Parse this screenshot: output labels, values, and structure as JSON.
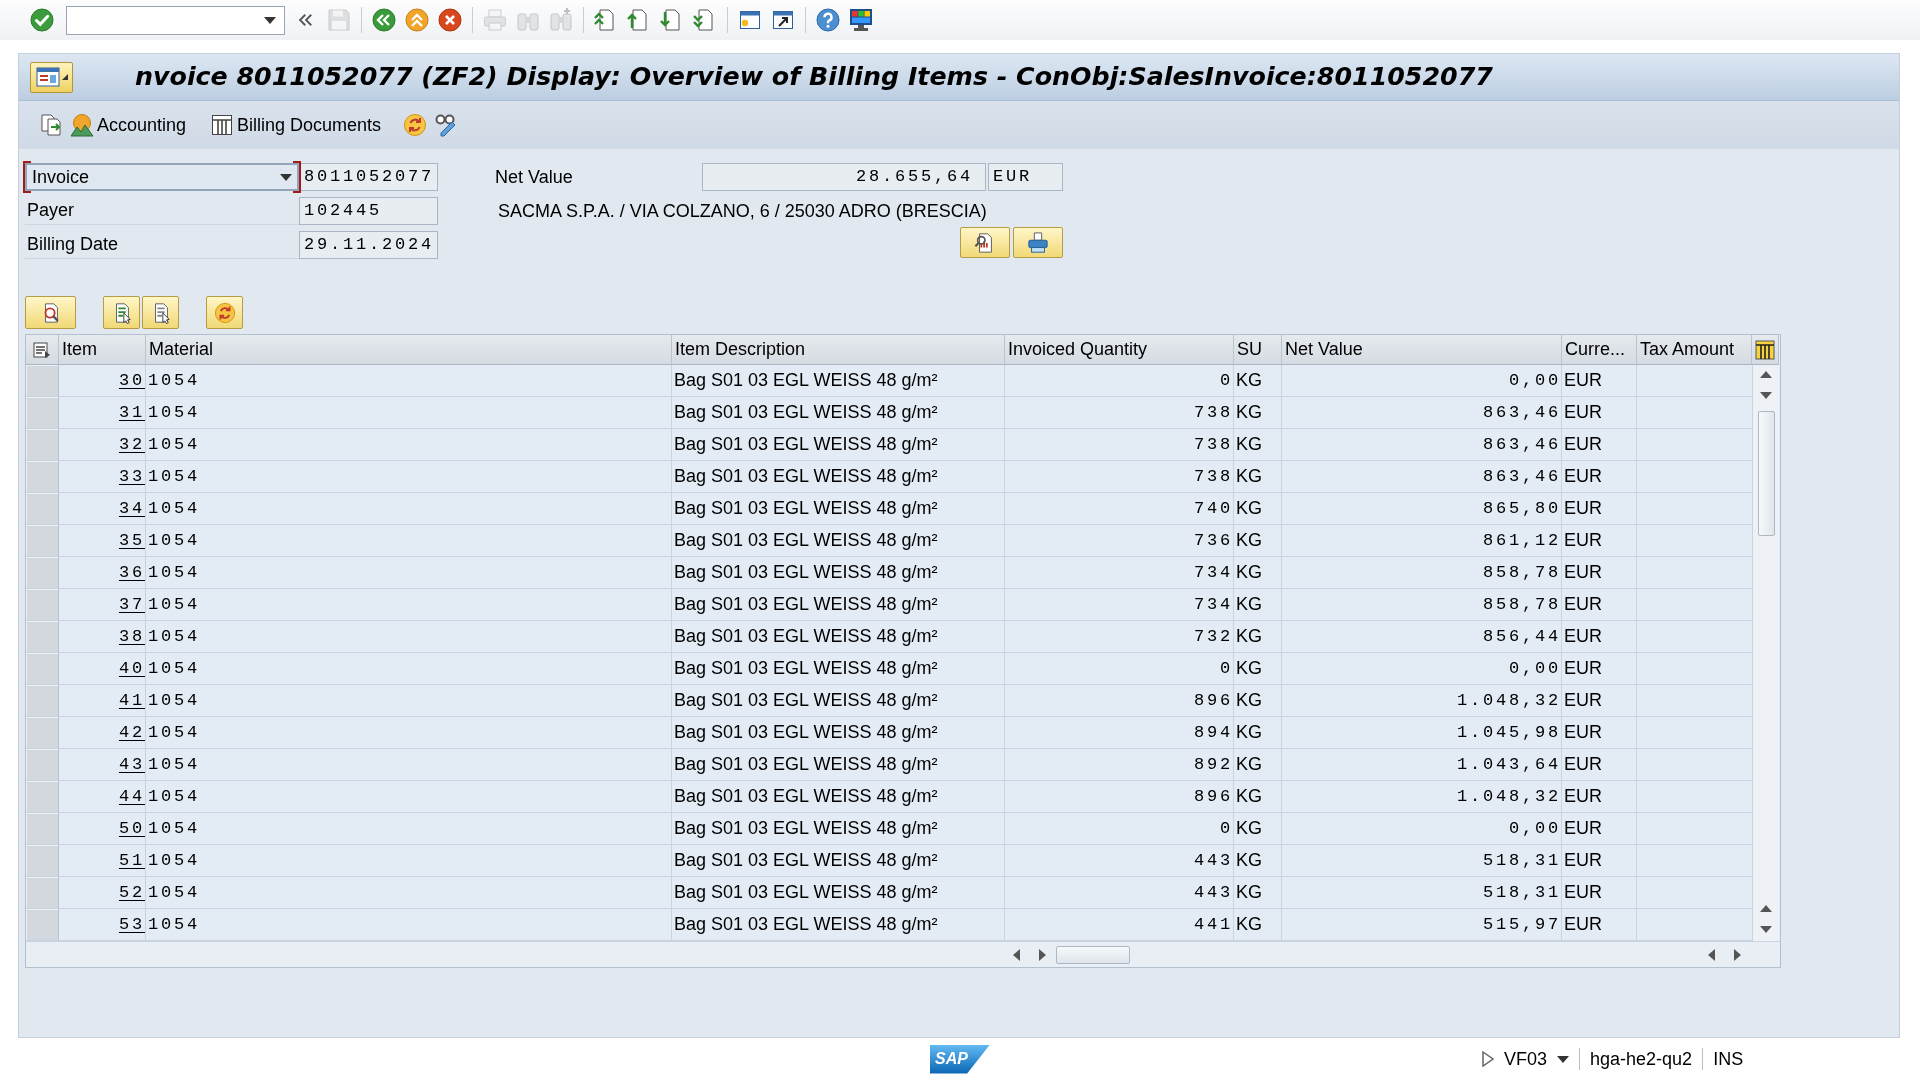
{
  "system_toolbar": [
    [
      {
        "kind": "enter",
        "disabled": false
      },
      {
        "kind": "command",
        "disabled": false
      },
      {
        "kind": "history",
        "disabled": false
      },
      {
        "kind": "save",
        "disabled": true
      }
    ],
    [
      {
        "kind": "back",
        "disabled": false
      },
      {
        "kind": "exit",
        "disabled": false
      },
      {
        "kind": "cancel",
        "disabled": false
      }
    ],
    [
      {
        "kind": "print",
        "disabled": true
      },
      {
        "kind": "find",
        "disabled": true
      },
      {
        "kind": "findnext",
        "disabled": true
      }
    ],
    [
      {
        "kind": "first",
        "disabled": false
      },
      {
        "kind": "previous",
        "disabled": false
      },
      {
        "kind": "next",
        "disabled": false
      },
      {
        "kind": "last",
        "disabled": false
      }
    ],
    [
      {
        "kind": "session",
        "disabled": false
      },
      {
        "kind": "shortcut",
        "disabled": false
      }
    ],
    [
      {
        "kind": "help",
        "disabled": false
      },
      {
        "kind": "customize",
        "disabled": false
      }
    ]
  ],
  "window": {
    "title": "nvoice 8011052077 (ZF2) Display: Overview of Billing Items - ConObj:SalesInvoice:8011052077"
  },
  "app_toolbar": [
    {
      "kind": "overview"
    },
    {
      "kind": "accounting",
      "label": "Accounting"
    },
    {
      "kind": "documents",
      "label": "Billing Documents"
    },
    {
      "kind": "flow"
    },
    {
      "kind": "display"
    }
  ],
  "header": {
    "document_type": {
      "value": "Invoice",
      "focused": true
    },
    "document_number": "8011052077",
    "fields": [
      {
        "label": "Payer",
        "value": "102445"
      },
      {
        "label": "Billing Date",
        "value": "29.11.2024"
      }
    ],
    "net_value": {
      "label": "Net Value",
      "value": "28.655,64",
      "currency": "EUR"
    },
    "payer_address": "SACMA S.P.A. / VIA COLZANO, 6 / 25030 ADRO (BRESCIA)",
    "buttons": [
      {
        "kind": "analysis"
      },
      {
        "kind": "output"
      }
    ]
  },
  "table_toolbar": [
    [
      {
        "kind": "details"
      }
    ],
    [
      {
        "kind": "select"
      },
      {
        "kind": "deselect"
      }
    ],
    [
      {
        "kind": "refresh"
      }
    ]
  ],
  "table": {
    "columns": [
      "Item",
      "Material",
      "Item Description",
      "Invoiced Quantity",
      "SU",
      "Net Value",
      "Curre...",
      "Tax Amount"
    ],
    "rows": [
      {
        "item": "30",
        "material": "1054",
        "description": "Bag S01 03 EGL WEISS 48 g/m²",
        "quantity": "0",
        "unit": "KG",
        "net_value": "0,00",
        "currency": "EUR",
        "selected": false
      },
      {
        "item": "31",
        "material": "1054",
        "description": "Bag S01 03 EGL WEISS 48 g/m²",
        "quantity": "738",
        "unit": "KG",
        "net_value": "863,46",
        "currency": "EUR",
        "selected": false
      },
      {
        "item": "32",
        "material": "1054",
        "description": "Bag S01 03 EGL WEISS 48 g/m²",
        "quantity": "738",
        "unit": "KG",
        "net_value": "863,46",
        "currency": "EUR",
        "selected": false
      },
      {
        "item": "33",
        "material": "1054",
        "description": "Bag S01 03 EGL WEISS 48 g/m²",
        "quantity": "738",
        "unit": "KG",
        "net_value": "863,46",
        "currency": "EUR",
        "selected": false
      },
      {
        "item": "34",
        "material": "1054",
        "description": "Bag S01 03 EGL WEISS 48 g/m²",
        "quantity": "740",
        "unit": "KG",
        "net_value": "865,80",
        "currency": "EUR",
        "selected": false
      },
      {
        "item": "35",
        "material": "1054",
        "description": "Bag S01 03 EGL WEISS 48 g/m²",
        "quantity": "736",
        "unit": "KG",
        "net_value": "861,12",
        "currency": "EUR",
        "selected": false
      },
      {
        "item": "36",
        "material": "1054",
        "description": "Bag S01 03 EGL WEISS 48 g/m²",
        "quantity": "734",
        "unit": "KG",
        "net_value": "858,78",
        "currency": "EUR",
        "selected": false
      },
      {
        "item": "37",
        "material": "1054",
        "description": "Bag S01 03 EGL WEISS 48 g/m²",
        "quantity": "734",
        "unit": "KG",
        "net_value": "858,78",
        "currency": "EUR",
        "selected": false
      },
      {
        "item": "38",
        "material": "1054",
        "description": "Bag S01 03 EGL WEISS 48 g/m²",
        "quantity": "732",
        "unit": "KG",
        "net_value": "856,44",
        "currency": "EUR",
        "selected": false
      },
      {
        "item": "40",
        "material": "1054",
        "description": "Bag S01 03 EGL WEISS 48 g/m²",
        "quantity": "0",
        "unit": "KG",
        "net_value": "0,00",
        "currency": "EUR",
        "selected": false
      },
      {
        "item": "41",
        "material": "1054",
        "description": "Bag S01 03 EGL WEISS 48 g/m²",
        "quantity": "896",
        "unit": "KG",
        "net_value": "1.048,32",
        "currency": "EUR",
        "selected": false
      },
      {
        "item": "42",
        "material": "1054",
        "description": "Bag S01 03 EGL WEISS 48 g/m²",
        "quantity": "894",
        "unit": "KG",
        "net_value": "1.045,98",
        "currency": "EUR",
        "selected": false
      },
      {
        "item": "43",
        "material": "1054",
        "description": "Bag S01 03 EGL WEISS 48 g/m²",
        "quantity": "892",
        "unit": "KG",
        "net_value": "1.043,64",
        "currency": "EUR",
        "selected": false
      },
      {
        "item": "44",
        "material": "1054",
        "description": "Bag S01 03 EGL WEISS 48 g/m²",
        "quantity": "896",
        "unit": "KG",
        "net_value": "1.048,32",
        "currency": "EUR",
        "selected": false
      },
      {
        "item": "50",
        "material": "1054",
        "description": "Bag S01 03 EGL WEISS 48 g/m²",
        "quantity": "0",
        "unit": "KG",
        "net_value": "0,00",
        "currency": "EUR",
        "selected": false
      },
      {
        "item": "51",
        "material": "1054",
        "description": "Bag S01 03 EGL WEISS 48 g/m²",
        "quantity": "443",
        "unit": "KG",
        "net_value": "518,31",
        "currency": "EUR",
        "selected": false
      },
      {
        "item": "52",
        "material": "1054",
        "description": "Bag S01 03 EGL WEISS 48 g/m²",
        "quantity": "443",
        "unit": "KG",
        "net_value": "518,31",
        "currency": "EUR",
        "selected": false
      },
      {
        "item": "53",
        "material": "1054",
        "description": "Bag S01 03 EGL WEISS 48 g/m²",
        "quantity": "441",
        "unit": "KG",
        "net_value": "515,97",
        "currency": "EUR",
        "selected": false
      }
    ]
  },
  "status_bar": {
    "logo": "SAP",
    "transaction": "VF03",
    "server": "hga-he2-qu2",
    "mode": "INS"
  }
}
